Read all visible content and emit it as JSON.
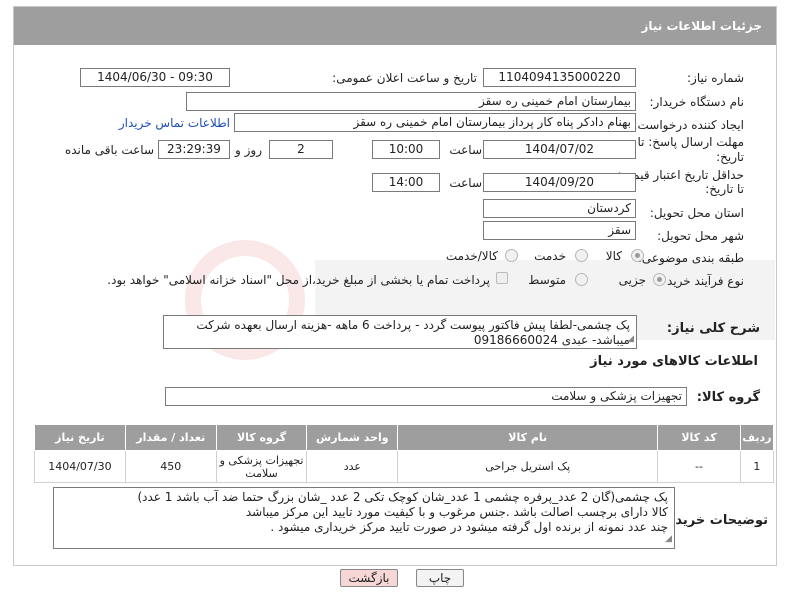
{
  "header": {
    "title": "جزئیات اطلاعات نیاز"
  },
  "fields": {
    "need_number_label": "شماره نیاز:",
    "need_number": "1104094135000220",
    "announce_label": "تاریخ و ساعت اعلان عمومی:",
    "announce_value": "1404/06/30 - 09:30",
    "buyer_org_label": "نام دستگاه خریدار:",
    "buyer_org": "بیمارستان امام خمینی  ره  سقز",
    "requester_label": "ایجاد کننده درخواست:",
    "requester": "بهنام دادکر پناه کار پرداز بیمارستان امام خمینی  ره  سقز",
    "contact_link": "اطلاعات تماس خریدار",
    "deadline_label_1": "مهلت ارسال پاسخ: تا",
    "deadline_label_2": "تاریخ:",
    "deadline_date": "1404/07/02",
    "time_label": "ساعت",
    "deadline_time": "10:00",
    "days_value": "2",
    "days_label": "روز و",
    "remaining_value": "23:29:39",
    "remaining_label": "ساعت باقی مانده",
    "validity_label_1": "حداقل تاریخ اعتبار قیمت:",
    "validity_label_2": "تا تاریخ:",
    "validity_date": "1404/09/20",
    "validity_time_label": "ساعت",
    "validity_time": "14:00",
    "province_label": "استان محل تحویل:",
    "province": "کردستان",
    "city_label": "شهر محل تحویل:",
    "city": "سقز",
    "category_label": "طبقه بندی موضوعی:",
    "category_options": [
      "کالا",
      "خدمت",
      "کالا/خدمت"
    ],
    "process_label": "نوع فرآیند خرید :",
    "process_options": [
      "جزیی",
      "متوسط"
    ],
    "payment_note": "پرداخت تمام یا بخشی از مبلغ خرید،از محل \"اسناد خزانه اسلامی\" خواهد بود."
  },
  "description": {
    "label": "شرح کلی نیاز:",
    "text": "پک چشمی-لطفا پیش فاکتور پیوست گردد - پرداخت 6 ماهه -هزینه ارسال بعهده شرکت میباشد- عبدی 09186660024"
  },
  "goods": {
    "section_title": "اطلاعات کالاهای مورد نیاز",
    "group_label": "گروه کالا:",
    "group_value": "تجهیزات پزشکی و سلامت",
    "columns": [
      "ردیف",
      "کد کالا",
      "نام کالا",
      "واحد شمارش",
      "گروه کالا",
      "تعداد / مقدار",
      "تاریخ نیاز"
    ],
    "rows": [
      {
        "row": "1",
        "code": "--",
        "name": "پک استریل جراحی",
        "unit": "عدد",
        "group": "تجهیزات پزشکی و سلامت",
        "qty": "450",
        "date": "1404/07/30"
      }
    ]
  },
  "buyer_notes": {
    "label": "توضیحات خریدار:",
    "line1": "پک چشمی(گان 2 عدد_پرفره چشمی 1 عدد_شان کوچک تکی 2 عدد _شان بزرگ  حتما ضد آب باشد 1 عدد)",
    "line2": "کالا دارای برچسب اصالت باشد .جنس مرغوب و با کیفیت مورد تایید این مرکز میباشد",
    "line3": "چند عدد نمونه از برنده اول گرفته میشود در صورت تایید مرکز خریداری میشود ."
  },
  "buttons": {
    "print": "چاپ",
    "back": "بازگشت"
  },
  "colors": {
    "header_bg": "#9e9e9e",
    "link": "#1e4fb0",
    "back_button": "#f7d6d6"
  }
}
